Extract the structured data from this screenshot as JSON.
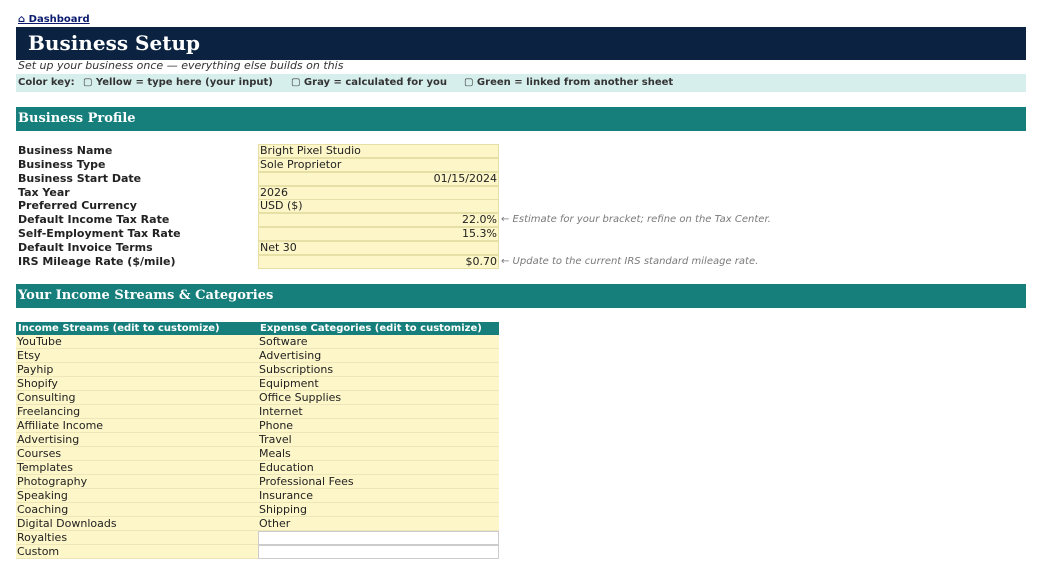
{
  "nav": {
    "dashboard_link": "⌂ Dashboard"
  },
  "header": {
    "title": "Business Setup",
    "subtitle": "Set up your business once — everything else builds on this"
  },
  "color_key": {
    "label": "Color key:",
    "yellow": "▢ Yellow = type here (your input)",
    "gray": "▢ Gray = calculated for you",
    "green": "▢ Green = linked from another sheet"
  },
  "business_profile": {
    "section_title": "Business Profile",
    "fields": [
      {
        "label": "Business Name",
        "value": "Bright Pixel Studio",
        "align": "left",
        "note": ""
      },
      {
        "label": "Business Type",
        "value": "Sole Proprietor",
        "align": "left",
        "note": ""
      },
      {
        "label": "Business Start Date",
        "value": "01/15/2024",
        "align": "right",
        "note": ""
      },
      {
        "label": "Tax Year",
        "value": "2026",
        "align": "left",
        "note": ""
      },
      {
        "label": "Preferred Currency",
        "value": "USD ($)",
        "align": "left",
        "note": ""
      },
      {
        "label": "Default Income Tax Rate",
        "value": "22.0%",
        "align": "right",
        "note": "← Estimate for your bracket; refine on the Tax Center."
      },
      {
        "label": "Self-Employment Tax Rate",
        "value": "15.3%",
        "align": "right",
        "note": ""
      },
      {
        "label": "Default Invoice Terms",
        "value": "Net 30",
        "align": "left",
        "note": ""
      },
      {
        "label": "IRS Mileage Rate ($/mile)",
        "value": "$0.70",
        "align": "right",
        "note": "← Update to the current IRS standard mileage rate."
      }
    ]
  },
  "streams": {
    "section_title": "Your Income Streams & Categories",
    "income_header": "Income Streams (edit to customize)",
    "expense_header": "Expense Categories (edit to customize)",
    "income": [
      "YouTube",
      "Etsy",
      "Payhip",
      "Shopify",
      "Consulting",
      "Freelancing",
      "Affiliate Income",
      "Advertising",
      "Courses",
      "Templates",
      "Photography",
      "Speaking",
      "Coaching",
      "Digital Downloads",
      "Royalties",
      "Custom"
    ],
    "expense": [
      "Software",
      "Advertising",
      "Subscriptions",
      "Equipment",
      "Office Supplies",
      "Internet",
      "Phone",
      "Travel",
      "Meals",
      "Education",
      "Professional Fees",
      "Insurance",
      "Shipping",
      "Other",
      "",
      ""
    ]
  },
  "colors": {
    "header_navy": "#0b2340",
    "section_teal": "#167f7b",
    "input_yellow": "#fdf6c8",
    "key_bar": "#d6efec"
  }
}
